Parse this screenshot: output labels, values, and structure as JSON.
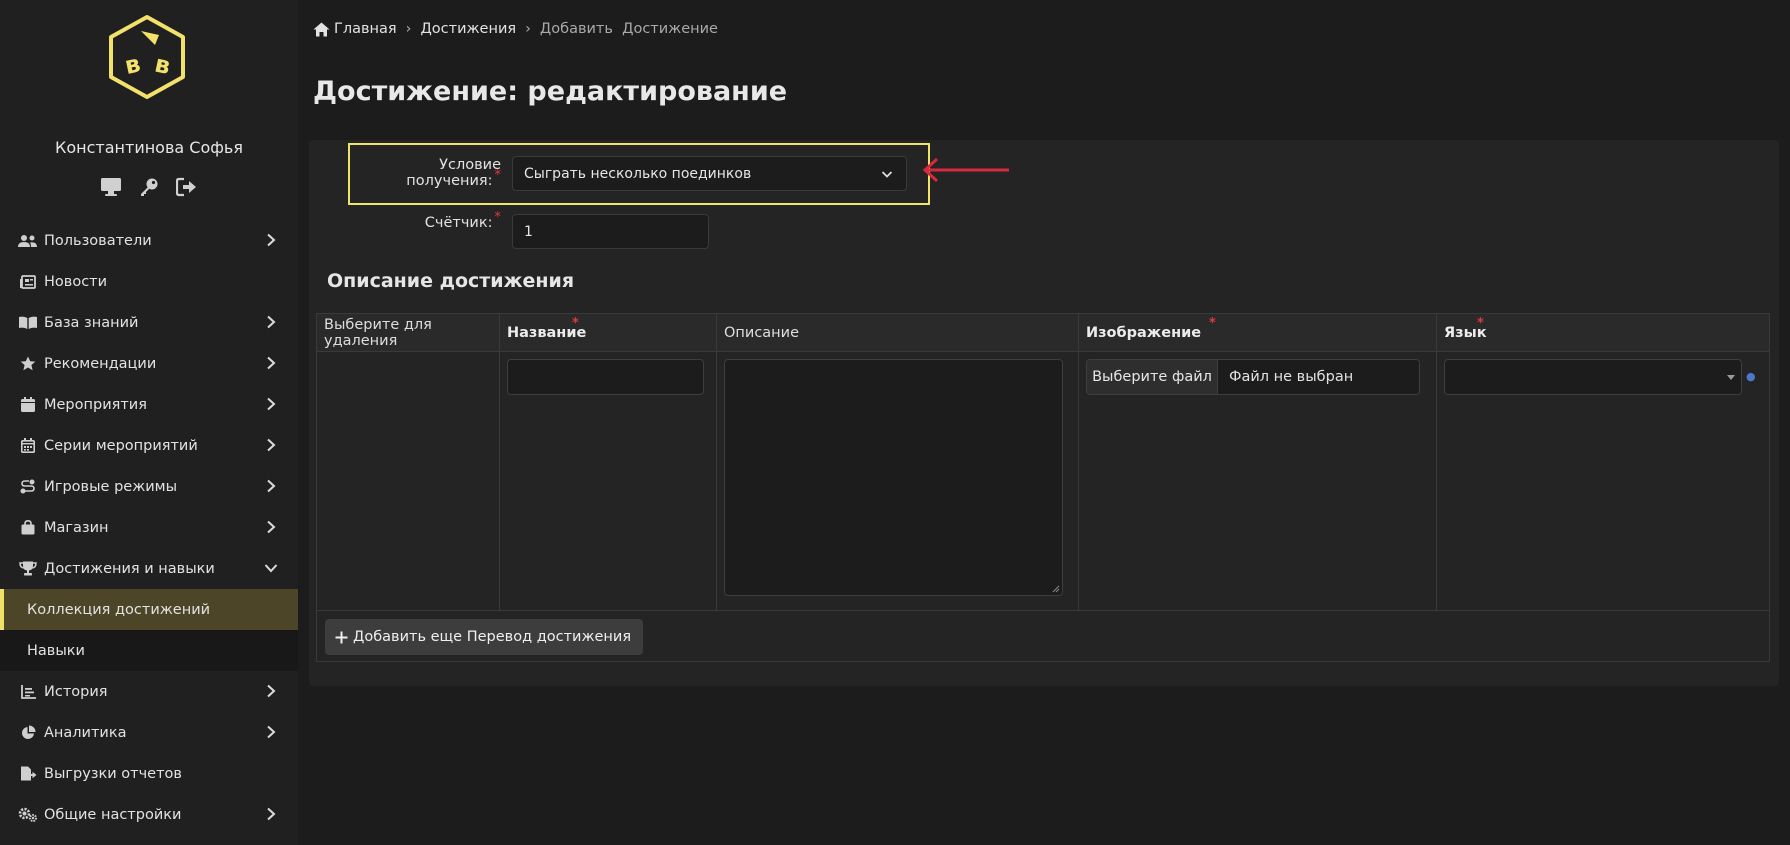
{
  "user": {
    "name": "Константинова Софья"
  },
  "user_icons": [
    "monitor-icon",
    "key-icon",
    "logout-icon"
  ],
  "sidebar": {
    "items": [
      {
        "label": "Пользователи",
        "icon": "users-icon",
        "expandable": true
      },
      {
        "label": "Новости",
        "icon": "newspaper-icon",
        "expandable": false
      },
      {
        "label": "База знаний",
        "icon": "book-icon",
        "expandable": true
      },
      {
        "label": "Рекомендации",
        "icon": "star-icon",
        "expandable": true
      },
      {
        "label": "Мероприятия",
        "icon": "calendar-icon",
        "expandable": true
      },
      {
        "label": "Серии мероприятий",
        "icon": "calendar-grid-icon",
        "expandable": true
      },
      {
        "label": "Игровые режимы",
        "icon": "route-icon",
        "expandable": true
      },
      {
        "label": "Магазин",
        "icon": "shopping-bag-icon",
        "expandable": true
      },
      {
        "label": "Достижения и навыки",
        "icon": "trophy-icon",
        "expandable": true,
        "expanded": true
      },
      {
        "label": "Коллекция достижений",
        "sub": true,
        "active": true
      },
      {
        "label": "Навыки",
        "sub": true
      },
      {
        "label": "История",
        "icon": "chart-line-icon",
        "expandable": true
      },
      {
        "label": "Аналитика",
        "icon": "pie-chart-icon",
        "expandable": true
      },
      {
        "label": "Выгрузки отчетов",
        "icon": "file-export-icon",
        "expandable": false
      },
      {
        "label": "Общие настройки",
        "icon": "cogs-icon",
        "expandable": true
      }
    ]
  },
  "breadcrumb": {
    "home": "Главная",
    "section": "Достижения",
    "current": "Добавить  Достижение",
    "separator": "›"
  },
  "page_title": "Достижение: редактирование",
  "form": {
    "condition_label": "Условие получения:",
    "condition_value": "Сыграть несколько поединков",
    "counter_label": "Счётчик:",
    "counter_value": "1",
    "required_mark": "*"
  },
  "description_section": {
    "title": "Описание достижения",
    "columns": {
      "delete": "Выберите для удаления",
      "name": "Название",
      "description": "Описание",
      "image": "Изображение",
      "language": "Язык"
    },
    "file_button": "Выберите файл",
    "file_status": "Файл не выбран",
    "add_button": "Добавить еще Перевод достижения"
  },
  "colors": {
    "highlight": "#f0e36a",
    "arrow": "#d6283f",
    "active_nav": "#4c4527",
    "required": "#e03a3a"
  }
}
